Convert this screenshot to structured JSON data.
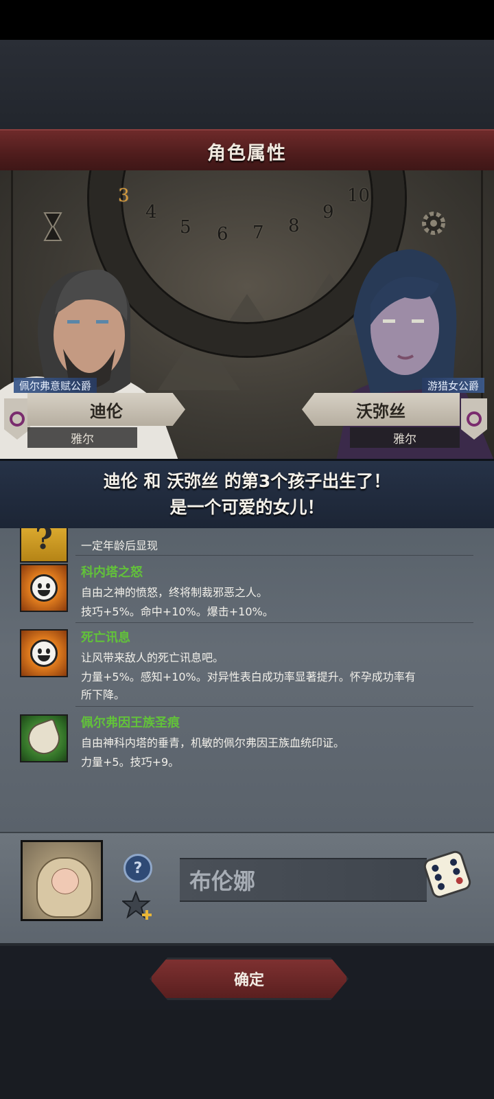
{
  "header": {
    "title": "角色属性"
  },
  "scene": {
    "dial_numbers": [
      "3",
      "4",
      "5",
      "6",
      "7",
      "8",
      "9",
      "10"
    ],
    "active_number": "3"
  },
  "father": {
    "title": "佩尔弗意赋公爵",
    "name": "迪伦",
    "house": "雅尔"
  },
  "mother": {
    "title": "游猎女公爵",
    "name": "沃弥丝",
    "house": "雅尔"
  },
  "announcement": {
    "line1": "迪伦 和 沃弥丝 的第3个孩子出生了！",
    "line2": "是一个可爱的女儿！"
  },
  "traits": [
    {
      "icon": "question-icon",
      "name": "",
      "lines": [
        "一定年龄后显现"
      ]
    },
    {
      "icon": "sun-face-icon",
      "name": "科内塔之怒",
      "lines": [
        "自由之神的愤怒，终将制裁邪恶之人。",
        "技巧+5%。命中+10%。爆击+10%。"
      ]
    },
    {
      "icon": "sun-face-icon",
      "name": "死亡讯息",
      "lines": [
        "让风带来敌人的死亡讯息吧。",
        "力量+5%。感知+10%。对异性表白成功率显著提升。怀孕成功率有",
        "所下降。"
      ]
    },
    {
      "icon": "leaf-crest-icon",
      "name": "佩尔弗因王族圣痕",
      "lines": [
        "自由神科内塔的垂青，机敏的佩尔弗因王族血统印证。",
        "力量+5。技巧+9。"
      ]
    }
  ],
  "child": {
    "name_value": "布伦娜",
    "help_label": "?"
  },
  "confirm_label": "确定",
  "colors": {
    "accent_red": "#6e2a2a",
    "trait_green": "#62c23a",
    "announce_bg": "#263247"
  }
}
